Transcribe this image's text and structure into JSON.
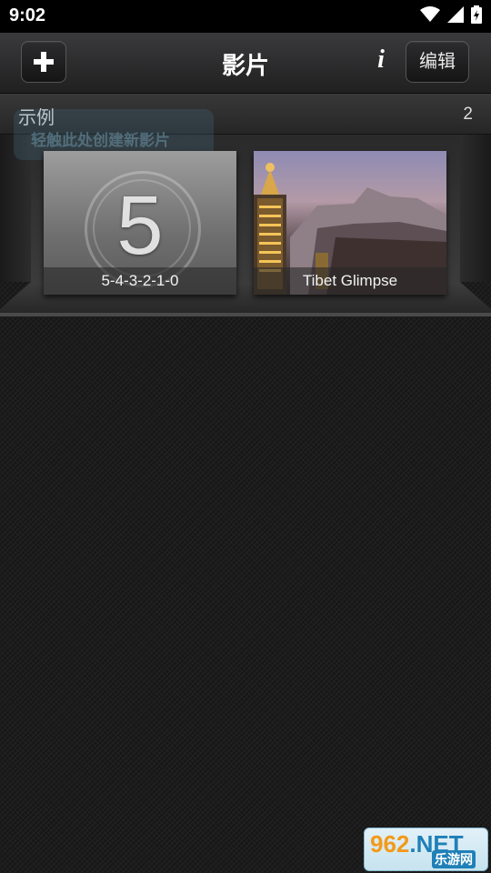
{
  "status_bar": {
    "time": "9:02"
  },
  "toolbar": {
    "title": "影片",
    "info_label": "i",
    "edit_label": "编辑"
  },
  "section": {
    "name": "示例",
    "count": "2"
  },
  "hint": {
    "text": "轻触此处创建新影片"
  },
  "movies": [
    {
      "title": "5-4-3-2-1-0",
      "thumbnail_text": "5"
    },
    {
      "title": "Tibet Glimpse"
    }
  ],
  "watermark": {
    "main": "962",
    "suffix": ".NET",
    "sub": "乐游网"
  }
}
